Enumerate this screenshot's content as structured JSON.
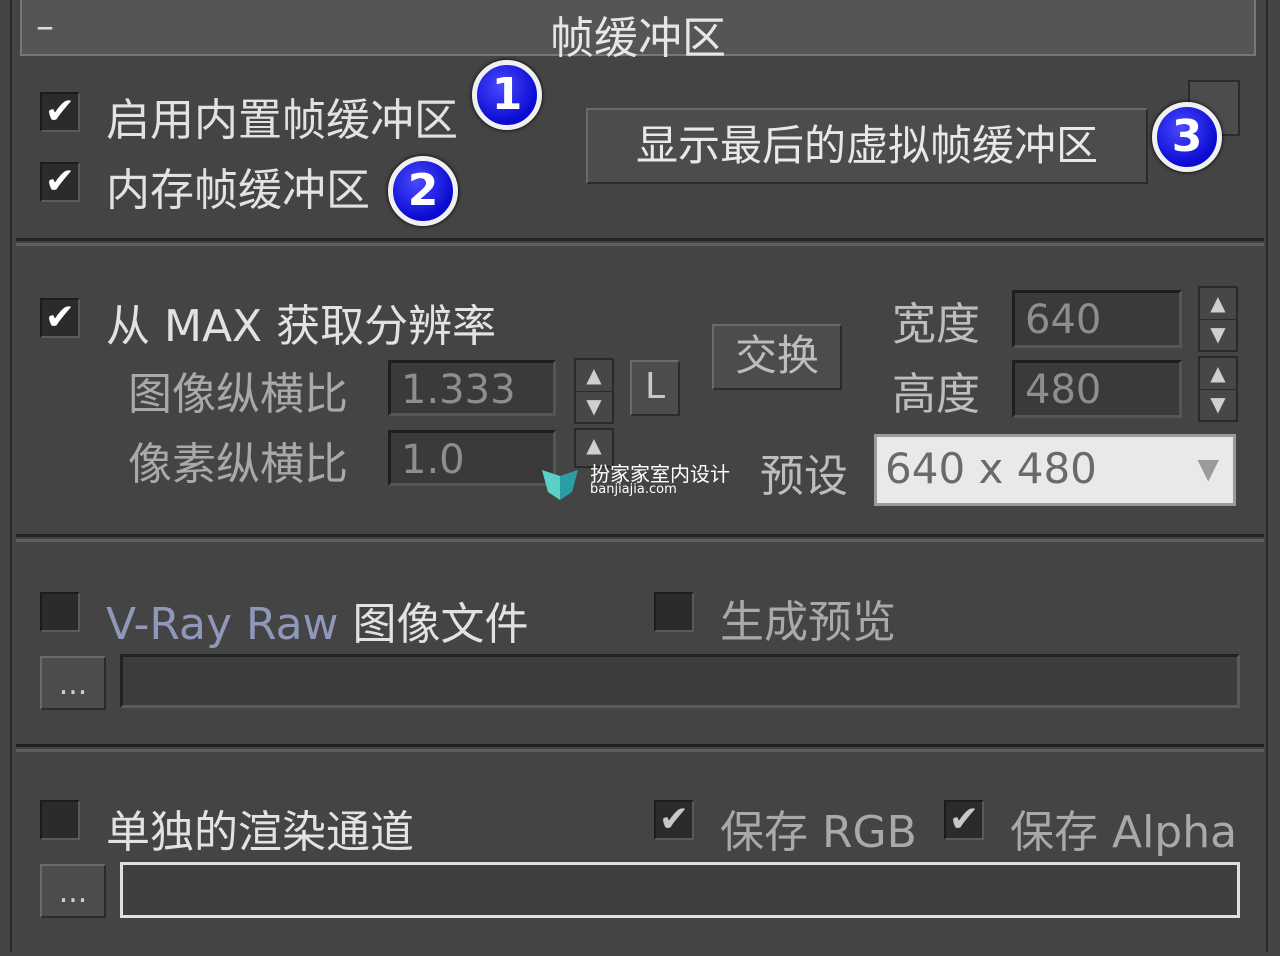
{
  "header": {
    "collapse_symbol": "–",
    "title": "帧缓冲区"
  },
  "section1": {
    "enable_builtin_fb": {
      "label": "启用内置帧缓冲区",
      "checked": true,
      "badge": "1"
    },
    "memory_fb": {
      "label": "内存帧缓冲区",
      "checked": true,
      "badge": "2"
    },
    "show_last_vfb_button": "显示最后的虚拟帧缓冲区",
    "badge3": "3",
    "check_mark": "✔"
  },
  "section2": {
    "get_resolution_from_max": {
      "label": "从 MAX 获取分辨率",
      "checked": true
    },
    "image_aspect_label": "图像纵横比",
    "image_aspect_value": "1.333",
    "lock_button": "L",
    "pixel_aspect_label": "像素纵横比",
    "pixel_aspect_value": "1.0",
    "swap_button": "交换",
    "width_label": "宽度",
    "width_value": "640",
    "height_label": "高度",
    "height_value": "480",
    "preset_label": "预设",
    "preset_value": "640 x 480",
    "spinner_up": "▲",
    "spinner_down": "▼",
    "dropdown_arrow": "▼"
  },
  "section3": {
    "vray_raw": {
      "label_prefix": "V-Ray Raw",
      "label_suffix": "图像文件",
      "checked": false
    },
    "generate_preview": {
      "label": "生成预览",
      "checked": false
    },
    "browse_button": "..."
  },
  "section4": {
    "separate_channels": {
      "label": "单独的渲染通道",
      "checked": false
    },
    "save_rgb": {
      "label": "保存 RGB",
      "checked": true
    },
    "save_alpha": {
      "label": "保存 Alpha",
      "checked": true
    },
    "browse_button": "..."
  },
  "watermark": {
    "cn": "扮家家室内设计",
    "en": "banjiajia.com"
  }
}
